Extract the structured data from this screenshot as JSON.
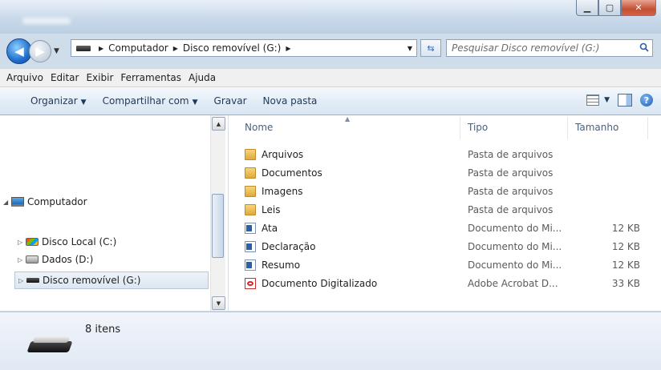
{
  "window": {
    "controls": [
      "minimize-icon",
      "maximize-icon",
      "close-icon"
    ]
  },
  "address_bar": {
    "breadcrumbs": [
      "Computador",
      "Disco removível (G:)"
    ],
    "search_placeholder": "Pesquisar Disco removível (G:)"
  },
  "menu": {
    "items": [
      "Arquivo",
      "Editar",
      "Exibir",
      "Ferramentas",
      "Ajuda"
    ]
  },
  "toolbar": {
    "organize_label": "Organizar",
    "share_label": "Compartilhar com",
    "burn_label": "Gravar",
    "new_folder_label": "Nova pasta"
  },
  "navigation": {
    "computer_label": "Computador",
    "drives": [
      {
        "label": "Disco Local (C:)",
        "icon": "windows-drive-icon"
      },
      {
        "label": "Dados (D:)",
        "icon": "hard-drive-icon"
      },
      {
        "label": "Disco removível (G:)",
        "icon": "usb-drive-icon",
        "selected": true
      }
    ]
  },
  "file_list": {
    "columns": {
      "name": "Nome",
      "type": "Tipo",
      "size": "Tamanho"
    },
    "files": [
      {
        "name": "Arquivos",
        "type": "Pasta de arquivos",
        "size": "",
        "icon": "folder-icon"
      },
      {
        "name": "Documentos",
        "type": "Pasta de arquivos",
        "size": "",
        "icon": "folder-icon"
      },
      {
        "name": "Imagens",
        "type": "Pasta de arquivos",
        "size": "",
        "icon": "folder-icon"
      },
      {
        "name": "Leis",
        "type": "Pasta de arquivos",
        "size": "",
        "icon": "folder-icon"
      },
      {
        "name": "Ata",
        "type": "Documento do Mi...",
        "size": "12 KB",
        "icon": "word-document-icon"
      },
      {
        "name": "Declaração",
        "type": "Documento do Mi...",
        "size": "12 KB",
        "icon": "word-document-icon"
      },
      {
        "name": "Resumo",
        "type": "Documento do Mi...",
        "size": "12 KB",
        "icon": "word-document-icon"
      },
      {
        "name": "Documento Digitalizado",
        "type": "Adobe Acrobat D...",
        "size": "33 KB",
        "icon": "pdf-document-icon"
      }
    ]
  },
  "status": {
    "item_count": "8 itens"
  },
  "colors": {
    "accent": "#1e395b",
    "selection": "#dce6f2"
  }
}
